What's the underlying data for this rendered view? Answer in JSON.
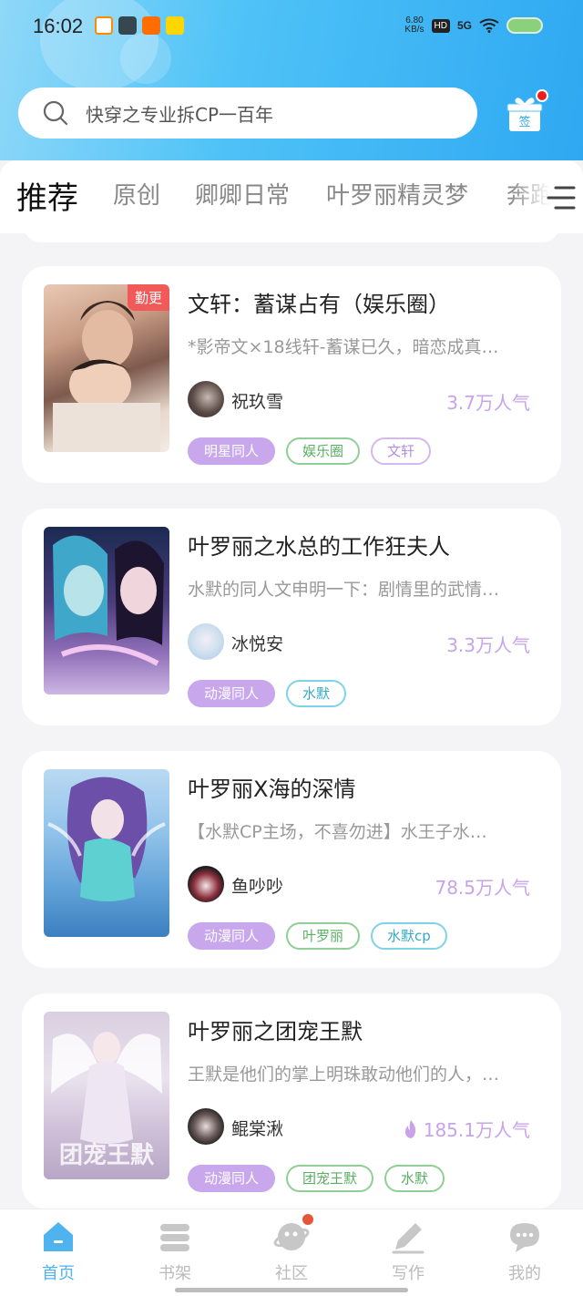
{
  "status_bar": {
    "time": "16:02",
    "net_speed_value": "6.80",
    "net_speed_unit": "KB/s",
    "hd": "HD",
    "signal": "5G"
  },
  "search": {
    "placeholder": "快穿之专业拆CP一百年"
  },
  "gift": {
    "label": "签"
  },
  "tabs": [
    {
      "label": "推荐",
      "active": true
    },
    {
      "label": "原创"
    },
    {
      "label": "卿卿日常"
    },
    {
      "label": "叶罗丽精灵梦"
    },
    {
      "label": "奔跑"
    }
  ],
  "books": [
    {
      "title": "文轩：蓄谋占有（娱乐圈）",
      "badge": "勤更",
      "description": "*影帝文×18线轩-蓄谋已久，暗恋成真…",
      "author": "祝玖雪",
      "popularity": "3.7万人气",
      "tags": [
        "明星同人",
        "娱乐圈",
        "文轩"
      ]
    },
    {
      "title": "叶罗丽之水总的工作狂夫人",
      "description": "水默的同人文申明一下：剧情里的武情…",
      "author": "冰悦安",
      "popularity": "3.3万人气",
      "tags": [
        "动漫同人",
        "水默"
      ]
    },
    {
      "title": "叶罗丽X海的深情",
      "description": "【水默CP主场，不喜勿进】水王子水…",
      "author": "鱼吵吵",
      "popularity": "78.5万人气",
      "tags": [
        "动漫同人",
        "叶罗丽",
        "水默cp"
      ]
    },
    {
      "title": "叶罗丽之团宠王默",
      "cover_text": "团宠王默",
      "description": "王默是他们的掌上明珠敢动他们的人，…",
      "author": "鲲棠湫",
      "popularity": "185.1万人气",
      "tags": [
        "动漫同人",
        "团宠王默",
        "水默"
      ]
    }
  ],
  "bottom_nav": [
    {
      "label": "首页",
      "icon": "home-icon",
      "active": true
    },
    {
      "label": "书架",
      "icon": "bookshelf-icon"
    },
    {
      "label": "社区",
      "icon": "planet-icon"
    },
    {
      "label": "写作",
      "icon": "pen-icon"
    },
    {
      "label": "我的",
      "icon": "chat-bubble-icon"
    }
  ],
  "colors": {
    "accent": "#a77be6",
    "header": "#4fc3f7",
    "nav_active": "#4fb3f0",
    "popularity": "#c8a3ea"
  }
}
